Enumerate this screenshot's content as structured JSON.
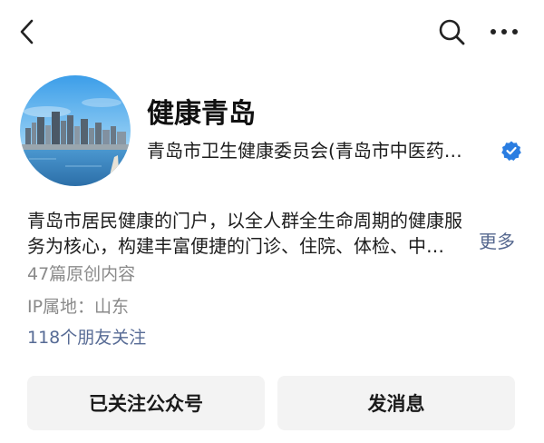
{
  "header": {
    "back_icon": "chevron-left-icon",
    "search_icon": "search-icon",
    "more_icon": "more-horizontal-icon"
  },
  "profile": {
    "name": "健康青岛",
    "owner": "青岛市卫生健康委员会(青岛市中医药…",
    "verified_icon": "verified-badge-icon",
    "verified_color": "#2a7de1",
    "description_line1": "青岛市居民健康的门户，以全人群全生命周期的健康服",
    "description_line2": "务为核心，构建丰富便捷的门诊、住院、体检、中…",
    "more_label": "更多",
    "articles": "47篇原创内容",
    "ip_location": "IP属地：山东",
    "friends_following": "118个朋友关注"
  },
  "actions": {
    "followed_label": "已关注公众号",
    "message_label": "发消息"
  },
  "colors": {
    "link": "#576b95",
    "meta": "#8a8a8a",
    "button_bg": "#f3f3f3"
  }
}
